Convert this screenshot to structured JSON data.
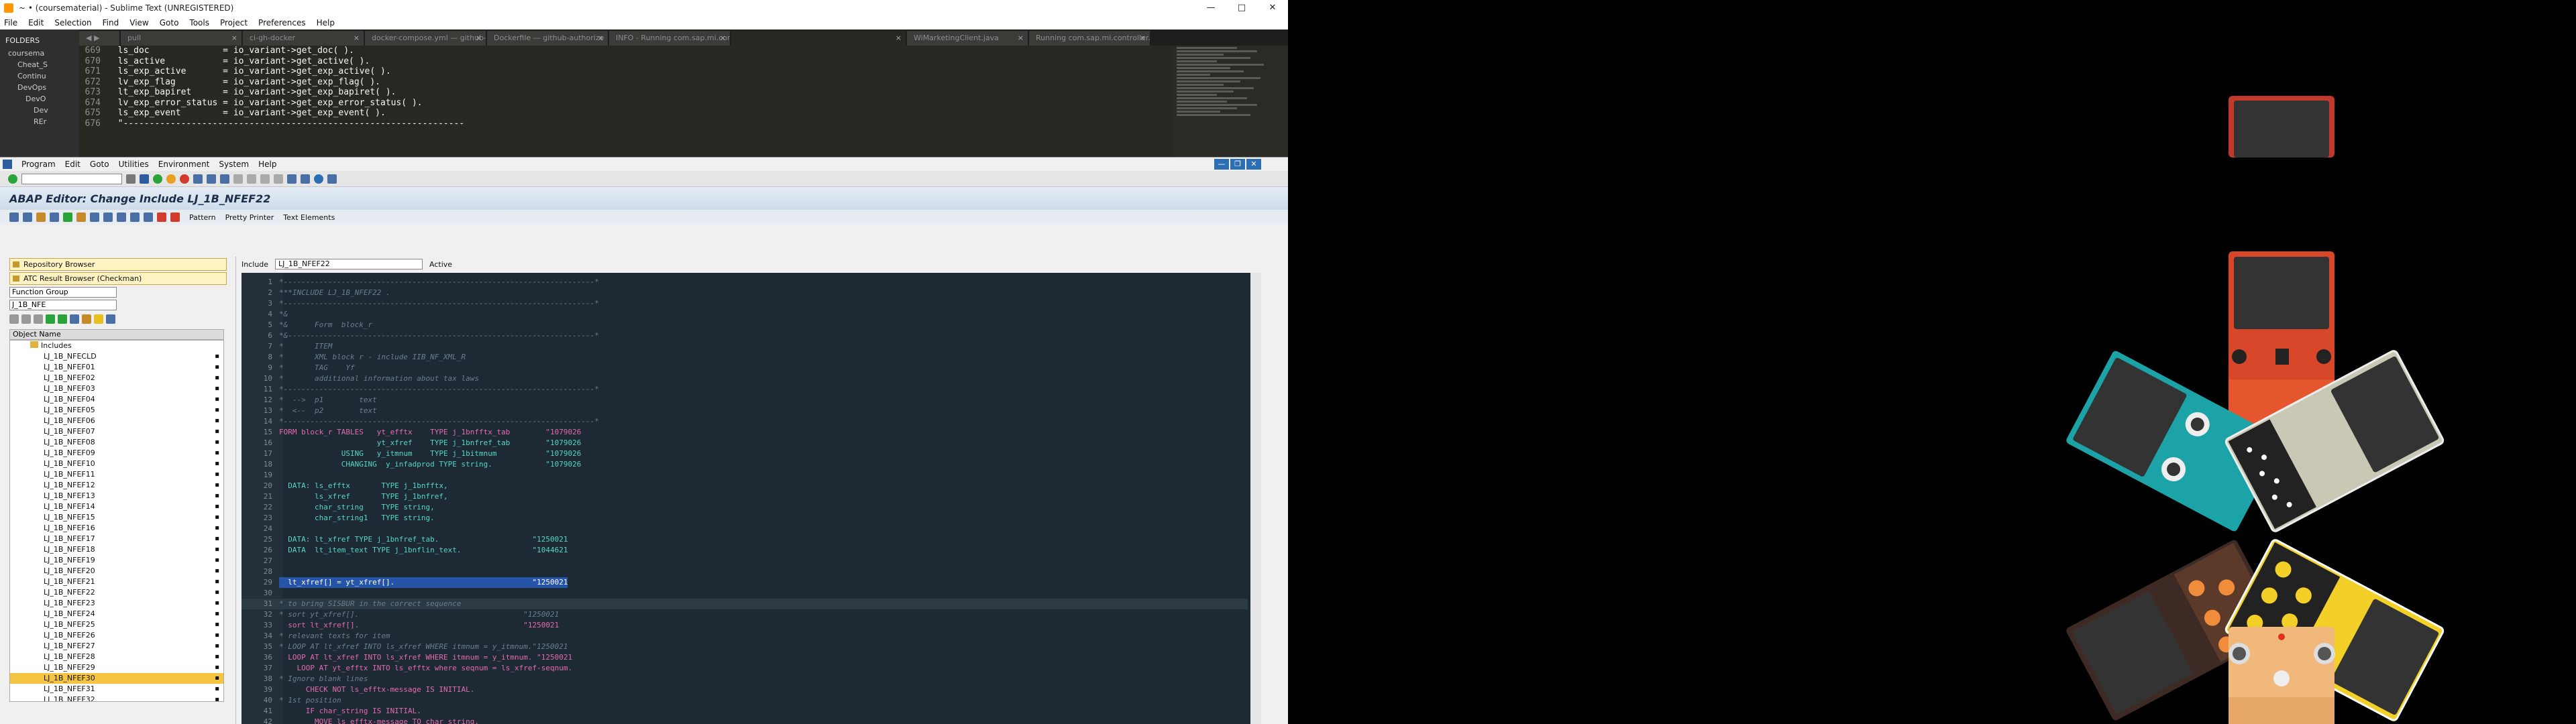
{
  "sublime": {
    "title": "~ • (coursematerial) - Sublime Text (UNREGISTERED)",
    "window_controls": [
      "—",
      "□",
      "✕"
    ],
    "menu": [
      "File",
      "Edit",
      "Selection",
      "Find",
      "View",
      "Goto",
      "Tools",
      "Project",
      "Preferences",
      "Help"
    ],
    "sidebar": {
      "header": "FOLDERS",
      "items": [
        "coursema",
        "Cheat_S",
        "Continu",
        "DevOps",
        "DevO",
        "Dev",
        "REr"
      ]
    },
    "tabs": [
      {
        "label": "pull"
      },
      {
        "label": "ci-gh-docker"
      },
      {
        "label": "docker-compose.yml — github-authorize"
      },
      {
        "label": "Dockerfile — github-authorize"
      },
      {
        "label": "INFO - Running com.sap.mi.controller.BatchControl"
      },
      {
        "label": ""
      },
      {
        "label": "WiMarketingClient.java"
      },
      {
        "label": "Running com.sap.mi.controller.BatchContro"
      }
    ],
    "lines": [
      {
        "n": "669",
        "text": "  ls_doc              = io_variant->get_doc( )."
      },
      {
        "n": "670",
        "text": "  ls_active           = io_variant->get_active( )."
      },
      {
        "n": "671",
        "text": "  ls_exp_active       = io_variant->get_exp_active( )."
      },
      {
        "n": "672",
        "text": "  lv_exp_flag         = io_variant->get_exp_flag( )."
      },
      {
        "n": "673",
        "text": "  lt_exp_bapiret      = io_variant->get_exp_bapiret( )."
      },
      {
        "n": "674",
        "text": "  lv_exp_error_status = io_variant->get_exp_error_status( )."
      },
      {
        "n": "675",
        "text": "  ls_exp_event        = io_variant->get_exp_event( )."
      },
      {
        "n": "676",
        "text": "  \"-----------------------------------------------------------------"
      }
    ]
  },
  "sap": {
    "menu": [
      "Program",
      "Edit",
      "Goto",
      "Utilities",
      "Environment",
      "System",
      "Help"
    ],
    "title": "ABAP Editor: Change Include LJ_1B_NFEF22",
    "app_toolbar": [
      "Pattern",
      "Pretty Printer",
      "Text Elements"
    ],
    "nav": {
      "repo_browser": "Repository Browser",
      "atc_browser": "ATC Result Browser (Checkman)",
      "object_type": "Function Group",
      "object_name": "J_1B_NFE",
      "tree_header": "Object Name",
      "folder": "Includes",
      "items": [
        "LJ_1B_NFECLD",
        "LJ_1B_NFEF01",
        "LJ_1B_NFEF02",
        "LJ_1B_NFEF03",
        "LJ_1B_NFEF04",
        "LJ_1B_NFEF05",
        "LJ_1B_NFEF06",
        "LJ_1B_NFEF07",
        "LJ_1B_NFEF08",
        "LJ_1B_NFEF09",
        "LJ_1B_NFEF10",
        "LJ_1B_NFEF11",
        "LJ_1B_NFEF12",
        "LJ_1B_NFEF13",
        "LJ_1B_NFEF14",
        "LJ_1B_NFEF15",
        "LJ_1B_NFEF16",
        "LJ_1B_NFEF17",
        "LJ_1B_NFEF18",
        "LJ_1B_NFEF19",
        "LJ_1B_NFEF20",
        "LJ_1B_NFEF21",
        "LJ_1B_NFEF22",
        "LJ_1B_NFEF23",
        "LJ_1B_NFEF24",
        "LJ_1B_NFEF25",
        "LJ_1B_NFEF26",
        "LJ_1B_NFEF27",
        "LJ_1B_NFEF28",
        "LJ_1B_NFEF29",
        "LJ_1B_NFEF30",
        "LJ_1B_NFEF31",
        "LJ_1B_NFEF32"
      ],
      "selected_index": 30
    },
    "include": {
      "label": "Include",
      "value": "LJ_1B_NFEF22",
      "status": "Active"
    },
    "code": [
      {
        "n": "1",
        "t": "*----------------------------------------------------------------------*",
        "c": "cmt"
      },
      {
        "n": "2",
        "t": "***INCLUDE LJ_1B_NFEF22 .",
        "c": "cmt"
      },
      {
        "n": "3",
        "t": "*----------------------------------------------------------------------*",
        "c": "cmt"
      },
      {
        "n": "4",
        "t": "*&",
        "c": "cmt"
      },
      {
        "n": "5",
        "t": "*&      Form  block_r",
        "c": "cmt"
      },
      {
        "n": "6",
        "t": "*&---------------------------------------------------------------------*",
        "c": "cmt"
      },
      {
        "n": "7",
        "t": "*       ITEM",
        "c": "cmt"
      },
      {
        "n": "8",
        "t": "*       XML block r - include IIB_NF_XML_R",
        "c": "cmt"
      },
      {
        "n": "9",
        "t": "*       TAG    Yf",
        "c": "cmt"
      },
      {
        "n": "10",
        "t": "*       additional information about tax laws",
        "c": "cmt"
      },
      {
        "n": "11",
        "t": "*----------------------------------------------------------------------*",
        "c": "cmt"
      },
      {
        "n": "12",
        "t": "*  -->  p1        text",
        "c": "cmt"
      },
      {
        "n": "13",
        "t": "*  <--  p2        text",
        "c": "cmt"
      },
      {
        "n": "14",
        "t": "*----------------------------------------------------------------------*",
        "c": "cmt"
      },
      {
        "n": "15",
        "t": "FORM block_r TABLES   yt_efftx    TYPE j_1bnfftx_tab        \"1079026",
        "c": "kw"
      },
      {
        "n": "16",
        "t": "                      yt_xfref    TYPE j_1bnfref_tab        \"1079026",
        "c": ""
      },
      {
        "n": "17",
        "t": "              USING   y_itmnum    TYPE j_1bitmnum           \"1079026",
        "c": ""
      },
      {
        "n": "18",
        "t": "              CHANGING  y_infadprod TYPE string.            \"1079026",
        "c": ""
      },
      {
        "n": "19",
        "t": "",
        "c": ""
      },
      {
        "n": "20",
        "t": "  DATA: ls_efftx       TYPE j_1bnfftx,",
        "c": ""
      },
      {
        "n": "21",
        "t": "        ls_xfref       TYPE j_1bnfref,",
        "c": ""
      },
      {
        "n": "22",
        "t": "        char_string    TYPE string,",
        "c": ""
      },
      {
        "n": "23",
        "t": "        char_string1   TYPE string.",
        "c": ""
      },
      {
        "n": "24",
        "t": "",
        "c": ""
      },
      {
        "n": "25",
        "t": "  DATA: lt_xfref TYPE j_1bnfref_tab.                     \"1250021",
        "c": ""
      },
      {
        "n": "26",
        "t": "  DATA  lt_item_text TYPE j_1bnflin_text.                \"1044621",
        "c": ""
      },
      {
        "n": "27",
        "t": "",
        "c": ""
      },
      {
        "n": "28",
        "t": "",
        "c": ""
      },
      {
        "n": "29",
        "t": "  lt_xfref[] = yt_xfref[].                               \"1250021",
        "c": "sel"
      },
      {
        "n": "30",
        "t": "",
        "c": ""
      },
      {
        "n": "31",
        "t": "* to bring SISBUR in the correct sequence",
        "c": "cmt cur"
      },
      {
        "n": "32",
        "t": "* sort yt_xfref[].                                     \"1250021",
        "c": "cmt"
      },
      {
        "n": "33",
        "t": "  sort lt_xfref[].                                     \"1250021",
        "c": "kw"
      },
      {
        "n": "34",
        "t": "* relevant texts for item",
        "c": "cmt"
      },
      {
        "n": "35",
        "t": "* LOOP AT lt_xfref INTO ls_xfref WHERE itmnum = y_itmnum.\"1250021",
        "c": "cmt"
      },
      {
        "n": "36",
        "t": "  LOOP AT lt_xfref INTO ls_xfref WHERE itmnum = y_itmnum. \"1250021",
        "c": "kw"
      },
      {
        "n": "37",
        "t": "    LOOP AT yt_efftx INTO ls_efftx where seqnum = ls_xfref-seqnum.",
        "c": "kw"
      },
      {
        "n": "38",
        "t": "* Ignore blank lines",
        "c": "cmt"
      },
      {
        "n": "39",
        "t": "      CHECK NOT ls_efftx-message IS INITIAL.",
        "c": "kw"
      },
      {
        "n": "40",
        "t": "* 1st position",
        "c": "cmt"
      },
      {
        "n": "41",
        "t": "      IF char_string IS INITIAL.",
        "c": "kw"
      },
      {
        "n": "42",
        "t": "        MOVE ls_efftx-message TO char_string.",
        "c": "kw"
      }
    ]
  },
  "colors": {
    "sublime_bg": "#272822",
    "abap_bg": "#1e2a33",
    "selection": "#2654a8",
    "nav_selected": "#f5c542"
  },
  "icons": [
    "sublime-app-icon",
    "sap-app-icon",
    "save-icon",
    "back-icon",
    "exit-icon",
    "cancel-icon",
    "print-icon",
    "find-icon",
    "help-icon",
    "settings-icon"
  ],
  "pedals": [
    {
      "name": "red-pedal-top",
      "color": "#c0392b"
    },
    {
      "name": "orange-pedal",
      "color": "#d9472b"
    },
    {
      "name": "teal-pedal",
      "color": "#1ba3a8"
    },
    {
      "name": "grey-pedal",
      "color": "#c9c8b4"
    },
    {
      "name": "brown-pedal",
      "color": "#3e2a24"
    },
    {
      "name": "yellow-pedal",
      "color": "#f2d027"
    },
    {
      "name": "tan-pedal",
      "color": "#f0b87a"
    }
  ]
}
